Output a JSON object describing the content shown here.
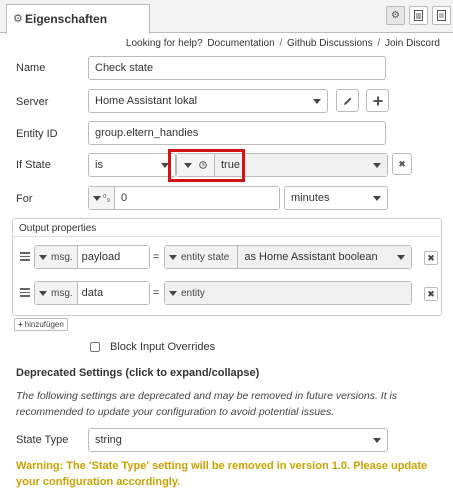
{
  "tab": {
    "title": "Eigenschaften"
  },
  "help": {
    "prefix": "Looking for help?",
    "doc": "Documentation",
    "sep": "/",
    "github": "Github Discussions",
    "discord": "Join Discord"
  },
  "fields": {
    "name": {
      "label": "Name",
      "value": "Check state"
    },
    "server": {
      "label": "Server",
      "value": "Home Assistant lokal"
    },
    "entity": {
      "label": "Entity ID",
      "value": "group.eltern_handies"
    },
    "ifstate": {
      "label": "If State",
      "operator": "is",
      "value": "true"
    },
    "for": {
      "label": "For",
      "value": "0",
      "unit": "minutes",
      "type_glyph": "⁰₉"
    }
  },
  "output": {
    "title": "Output properties",
    "rows": [
      {
        "prefix": "msg.",
        "property": "payload",
        "eq": "=",
        "type": "entity state",
        "value": "as Home Assistant boolean"
      },
      {
        "prefix": "msg.",
        "property": "data",
        "eq": "=",
        "type": "entity",
        "value": ""
      }
    ],
    "add_label": "hinzufügen"
  },
  "block": {
    "label": "Block Input Overrides"
  },
  "deprecated": {
    "title": "Deprecated Settings (click to expand/collapse)",
    "description": "The following settings are deprecated and may be removed in future versions. It is recommended to update your configuration to avoid potential issues.",
    "state_type_label": "State Type",
    "state_type_value": "string",
    "warning": "Warning: The 'State Type' setting will be removed in version 1.0. Please update your configuration accordingly."
  },
  "colors": {
    "highlight": "#d01414",
    "warning": "#c9a200"
  }
}
